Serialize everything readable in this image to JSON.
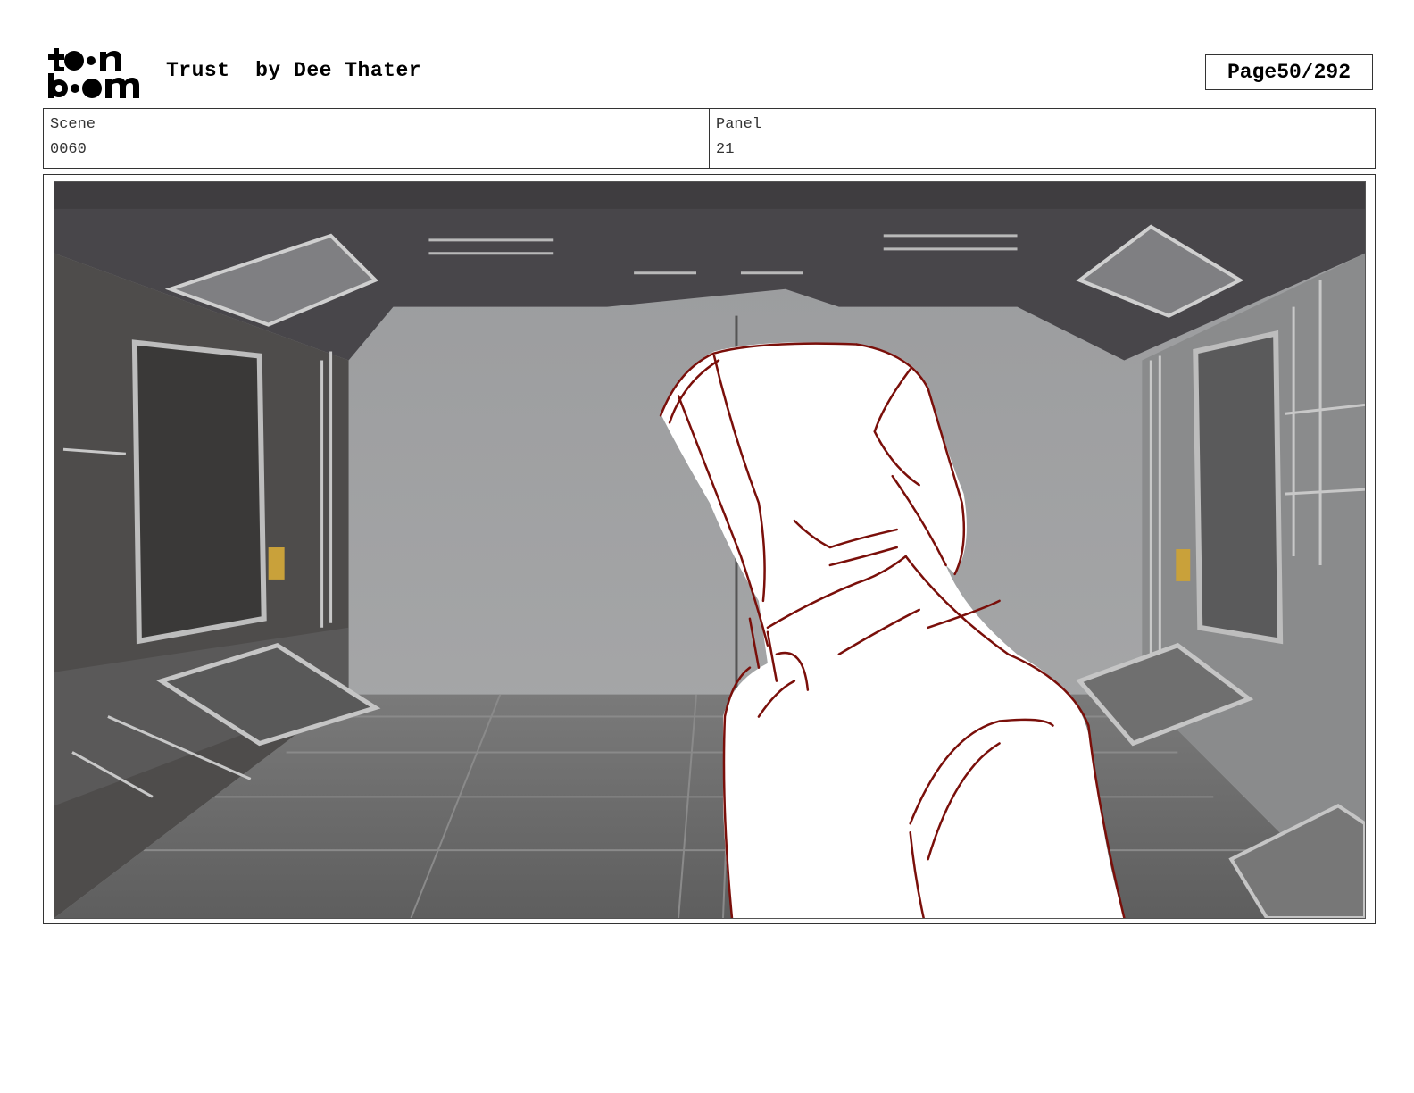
{
  "header": {
    "logo": {
      "icon": "toon-boom-logo",
      "line1": "toon",
      "line2": "boom"
    },
    "title": "Trust",
    "author": "by Dee Thater",
    "page_label": "Page",
    "page_value": "50/292"
  },
  "panel_info": {
    "scene_label": "Scene",
    "scene_value": "0060",
    "panel_label": "Panel",
    "panel_value": "21"
  },
  "artwork": {
    "icon": "storyboard-sketch",
    "colors": {
      "sketch": "#7a0f0a",
      "wall": "#a2a3a5",
      "structure": "#4a4846",
      "floor": "#6b6b6b"
    }
  }
}
